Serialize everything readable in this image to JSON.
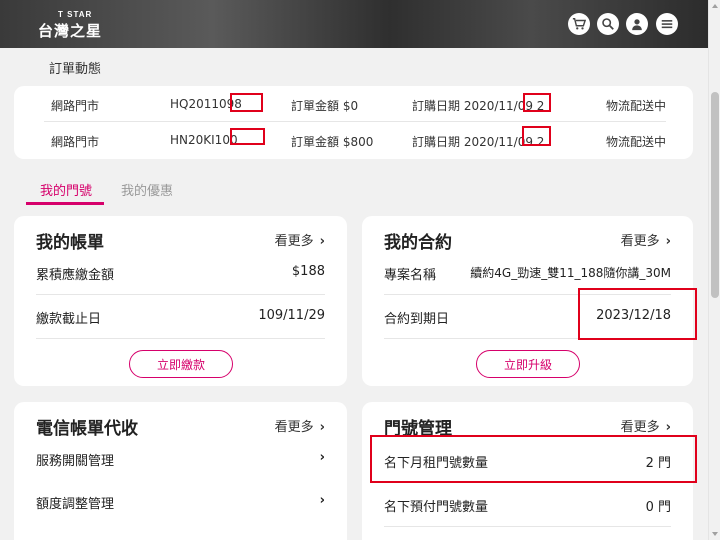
{
  "header": {
    "logo_small": "T STAR",
    "logo_main": "台灣之星",
    "icons": [
      "cart-icon",
      "search-icon",
      "user-icon",
      "menu-icon"
    ]
  },
  "orders": {
    "title": "訂單動態",
    "rows": [
      {
        "store": "網路門市",
        "id": "HQ2011098",
        "amount": "訂單金額 $0",
        "date": "訂購日期 2020/11/09 2",
        "status": "物流配送中"
      },
      {
        "store": "網路門市",
        "id": "HN20KI100",
        "amount": "訂單金額 $800",
        "date": "訂購日期 2020/11/09 2",
        "status": "物流配送中"
      }
    ]
  },
  "tabs": [
    {
      "label": "我的門號"
    },
    {
      "label": "我的優惠"
    }
  ],
  "bill": {
    "title": "我的帳單",
    "more": "看更多",
    "rows": [
      {
        "label": "累積應繳金額",
        "value": "$188"
      },
      {
        "label": "繳款截止日",
        "value": "109/11/29"
      }
    ],
    "button": "立即繳款"
  },
  "contract": {
    "title": "我的合約",
    "more": "看更多",
    "rows": [
      {
        "label": "專案名稱",
        "value": "續約4G_勁速_雙11_188隨你講_30M"
      },
      {
        "label": "合約到期日",
        "value": "2023/12/18"
      }
    ],
    "button": "立即升級"
  },
  "telecom": {
    "title": "電信帳單代收",
    "more": "看更多",
    "rows": [
      {
        "label": "服務開關管理"
      },
      {
        "label": "額度調整管理"
      }
    ]
  },
  "numbers": {
    "title": "門號管理",
    "more": "看更多",
    "rows": [
      {
        "label": "名下月租門號數量",
        "value": "2 門"
      },
      {
        "label": "名下預付門號數量",
        "value": "0 門"
      }
    ]
  },
  "colors": {
    "accent": "#d6006b",
    "highlight_box": "#e0001b"
  }
}
